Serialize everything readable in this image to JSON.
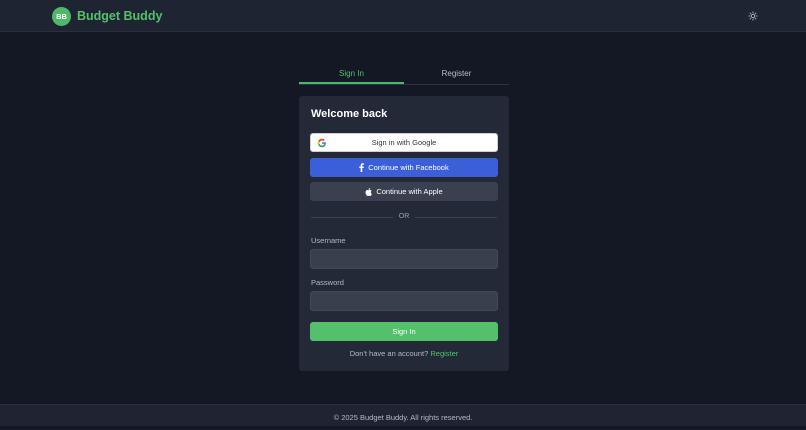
{
  "header": {
    "logo_initials": "BB",
    "brand_name": "Budget Buddy",
    "theme_icon": "sun-icon"
  },
  "tabs": [
    {
      "label": "Sign In",
      "active": true
    },
    {
      "label": "Register",
      "active": false
    }
  ],
  "card": {
    "title": "Welcome back",
    "google_label": "Sign in with Google",
    "facebook_label": "Continue with Facebook",
    "apple_label": "Continue with Apple",
    "divider_text": "OR",
    "username_label": "Username",
    "username_value": "",
    "password_label": "Password",
    "password_value": "",
    "submit_label": "Sign In",
    "register_prompt": "Don't have an account?",
    "register_link": "Register"
  },
  "footer": {
    "text": "© 2025 Budget Buddy. All rights reserved."
  },
  "colors": {
    "accent": "#55c06b",
    "facebook": "#3a5fd8",
    "background": "#141824",
    "card": "#242937"
  }
}
